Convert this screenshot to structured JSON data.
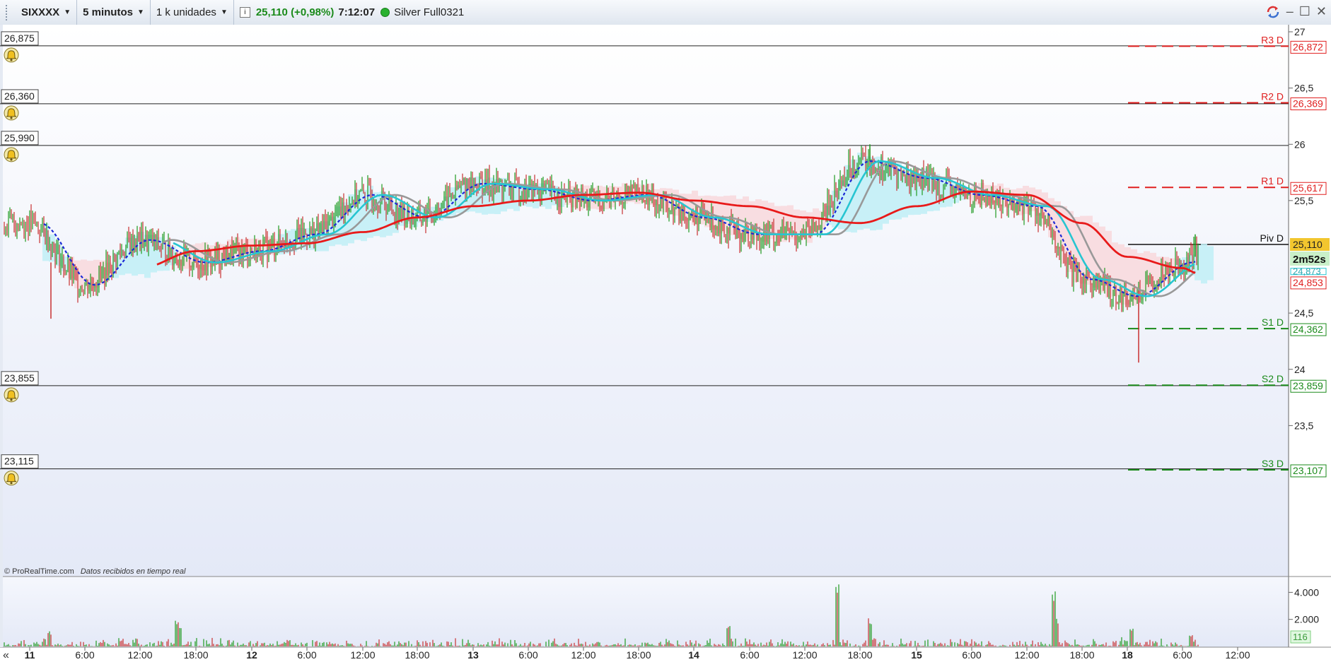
{
  "toolbar": {
    "instrument": "SIXXXX",
    "timeframe": "5 minutos",
    "units": "1 k unidades",
    "info_icon": "i",
    "price_change": "25,110 (+0,98%)",
    "clock": "7:12:07",
    "status_color": "#29b12f",
    "contract": "Silver Full0321",
    "window_controls": [
      "sync-icon",
      "minimize-icon",
      "maximize-icon",
      "close-icon"
    ]
  },
  "colors": {
    "sma_red": "#e81a1a",
    "ema_cyan": "#27c5d1",
    "sma_gray": "#999999",
    "dotted_blue": "#1a28d6",
    "resistance": "#e01f1f",
    "support": "#1a8a1a",
    "cloud_cyan": "#bfeef6",
    "cloud_pink": "#f8d8dc",
    "up_bar": "#1f9a1f",
    "down_bar": "#c83030",
    "background_top": "#ffffff",
    "background_bottom": "#e4e9f7"
  },
  "alerts": [
    {
      "label": "26,875",
      "value": 26.875
    },
    {
      "label": "26,360",
      "value": 26.36
    },
    {
      "label": "25,990",
      "value": 25.99
    },
    {
      "label": "23,855",
      "value": 23.855
    },
    {
      "label": "23,115",
      "value": 23.115
    }
  ],
  "pivots": [
    {
      "name": "R3 D",
      "value": 26.872,
      "label": "26,872",
      "kind": "resistance"
    },
    {
      "name": "R2 D",
      "value": 26.369,
      "label": "26,369",
      "kind": "resistance"
    },
    {
      "name": "R1 D",
      "value": 25.617,
      "label": "25,617",
      "kind": "resistance"
    },
    {
      "name": "Piv D",
      "value": 25.11,
      "label": "25,114",
      "kind": "pivot"
    },
    {
      "name": "S1 D",
      "value": 24.362,
      "label": "24,362",
      "kind": "support"
    },
    {
      "name": "S2 D",
      "value": 23.859,
      "label": "23,859",
      "kind": "support"
    },
    {
      "name": "S3 D",
      "value": 23.107,
      "label": "23,107",
      "kind": "support"
    }
  ],
  "price_axis": {
    "ticks": [
      "27",
      "26,5",
      "26",
      "25,5",
      "24,5",
      "24",
      "23,5"
    ],
    "tick_values": [
      27,
      26.5,
      26,
      25.5,
      24.5,
      24,
      23.5
    ],
    "last_price": "25,110",
    "countdown": "2m52s",
    "ema_value": "24,873",
    "sma_value": "24,853"
  },
  "credit": {
    "brand": "© ProRealTime.com",
    "note": "Datos recibidos en tiempo real"
  },
  "volume_axis": {
    "ticks": [
      "4.000",
      "2.000"
    ],
    "tick_values": [
      4000,
      2000
    ],
    "last_volume": "116"
  },
  "time_axis": {
    "scroll_icon": "«",
    "labels": [
      "11",
      "6:00",
      "12:00",
      "18:00",
      "12",
      "6:00",
      "12:00",
      "18:00",
      "13",
      "6:00",
      "12:00",
      "18:00",
      "14",
      "6:00",
      "12:00",
      "18:00",
      "15",
      "6:00",
      "12:00",
      "18:00",
      "18",
      "6:00",
      "12:00"
    ],
    "bold": [
      true,
      false,
      false,
      false,
      true,
      false,
      false,
      false,
      true,
      false,
      false,
      false,
      true,
      false,
      false,
      false,
      true,
      false,
      false,
      false,
      true,
      false,
      false
    ]
  },
  "chart_data": {
    "type": "line",
    "title": "",
    "xlabel": "",
    "ylabel": "",
    "ylim": [
      23.05,
      27.1
    ],
    "x": [
      "11 0:00",
      "11 6:00",
      "11 12:00",
      "11 18:00",
      "12 0:00",
      "12 6:00",
      "12 12:00",
      "12 18:00",
      "13 0:00",
      "13 6:00",
      "13 12:00",
      "13 18:00",
      "14 0:00",
      "14 6:00",
      "14 12:00",
      "14 18:00",
      "15 0:00",
      "15 6:00",
      "15 12:00",
      "15 18:00",
      "18 0:00",
      "18 6:00",
      "18 8:00"
    ],
    "series": [
      {
        "values": [
          25.3,
          24.75,
          25.15,
          24.95,
          25.05,
          25.2,
          25.55,
          25.35,
          25.65,
          25.6,
          25.5,
          25.55,
          25.35,
          25.2,
          25.2,
          25.85,
          25.7,
          25.55,
          25.45,
          24.8,
          24.65,
          24.95,
          25.05
        ]
      },
      {
        "values": [
          25.05,
          24.9,
          24.9,
          25.05,
          25.1,
          25.12,
          25.22,
          25.35,
          25.45,
          25.5,
          25.55,
          25.57,
          25.5,
          25.45,
          25.35,
          25.3,
          25.45,
          25.58,
          25.55,
          25.3,
          25.0,
          24.9,
          24.85
        ]
      }
    ],
    "volume": {
      "ylim": [
        0,
        4700
      ],
      "peaks": [
        4600,
        4300,
        2300,
        2100,
        2000
      ]
    }
  }
}
